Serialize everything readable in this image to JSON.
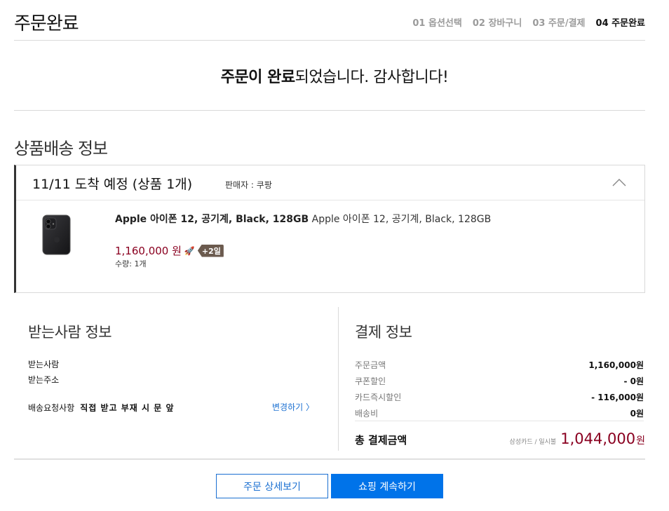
{
  "header": {
    "title": "주문완료",
    "steps": [
      "01 옵션선택",
      "02 장바구니",
      "03 주문/결제",
      "04 주문완료"
    ]
  },
  "complete_message": {
    "bold1": "주문이 완료",
    "rest": "되었습니다. 감사합니다!"
  },
  "delivery": {
    "section_title": "상품배송 정보",
    "date_label": "11/11 도착 예정 (상품 1개)",
    "seller": "판매자 : 쿠팡",
    "product": {
      "name_bold": "Apple 아이폰 12, 공기계, Black, 128GB",
      "name_rest": "Apple 아이폰 12, 공기계, Black, 128GB",
      "price": "1,160,000 원",
      "badge": "+2일",
      "quantity": "수량: 1개"
    }
  },
  "receiver": {
    "title": "받는사람 정보",
    "name_label": "받는사람",
    "address_label": "받는주소",
    "request_label": "배송요청사항",
    "request_value": "직접 받고 부재 시 문 앞",
    "change_link": "변경하기 〉"
  },
  "payment": {
    "title": "결제 정보",
    "rows": [
      {
        "label": "주문금액",
        "value": "1,160,000원"
      },
      {
        "label": "쿠폰할인",
        "value": "- 0원"
      },
      {
        "label": "카드즉시할인",
        "value": "- 116,000원"
      },
      {
        "label": "배송비",
        "value": "0원"
      }
    ],
    "total_label": "총 결제금액",
    "card_info": "삼성카드 / 일시불",
    "total_amount": "1,044,000",
    "total_unit": "원"
  },
  "buttons": {
    "detail": "주문 상세보기",
    "continue": "쇼핑 계속하기"
  },
  "colors": {
    "accent_blue": "#0073e9",
    "price_red": "#8a0020"
  }
}
